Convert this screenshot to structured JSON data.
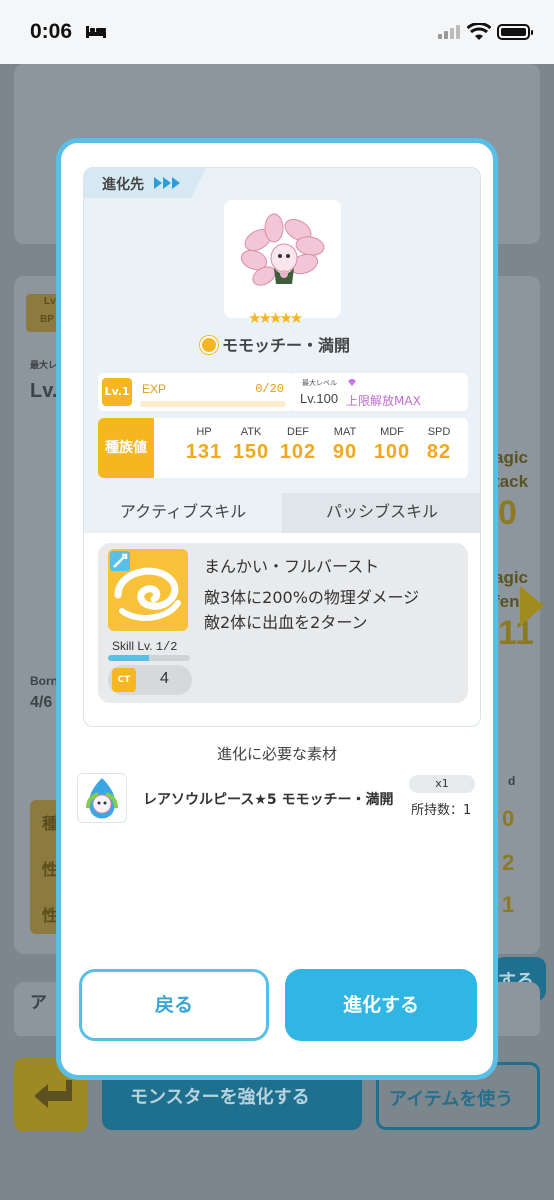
{
  "status_bar": {
    "time": "0:06"
  },
  "background": {
    "lv_badge": "Lv",
    "bp_label": "BP",
    "max_level_label": "最大レ",
    "lv_value": "Lv.",
    "born_label": "Born",
    "born_value": "4/6",
    "magic_attack_1": "agic",
    "magic_attack_2": "tack",
    "magic_attack_value": "0",
    "magic_defense_1": "agic",
    "magic_defense_2": "fen",
    "magic_defense_value": "11",
    "col_header": "d",
    "row_values": [
      "0",
      "2",
      "1"
    ],
    "row_label_1": "種",
    "row_label_2": "性",
    "row_label_3": "性",
    "evolve_btn_partial": "する",
    "item_label": "ア",
    "enhance_button": "モンスターを強化する",
    "use_item_button": "アイテムを使う"
  },
  "modal": {
    "header_tag": "進化先",
    "monster_name": "モモッチー・満開",
    "stars": "★★★★★",
    "level": {
      "badge": "Lv.1",
      "exp_label": "EXP",
      "exp_value": "0/20",
      "exp_progress": 0
    },
    "max_level": {
      "label": "最大レベル",
      "value": "Lv.100",
      "limit_text": "上限解放MAX"
    },
    "stats": {
      "label": "種族値",
      "items": [
        {
          "name": "HP",
          "value": "131"
        },
        {
          "name": "ATK",
          "value": "150"
        },
        {
          "name": "DEF",
          "value": "102"
        },
        {
          "name": "MAT",
          "value": "90"
        },
        {
          "name": "MDF",
          "value": "100"
        },
        {
          "name": "SPD",
          "value": "82"
        }
      ]
    },
    "tabs": {
      "active": "アクティブスキル",
      "passive": "パッシブスキル"
    },
    "skill": {
      "name": "まんかい・フルバースト",
      "desc_line1": "敵3体に200%の物理ダメージ",
      "desc_line2": "敵2体に出血を2ターン",
      "level_label": "Skill Lv.",
      "level_value": "1/2",
      "level_progress": 0.5,
      "ct_label": "CT",
      "ct_value": "4"
    },
    "materials": {
      "title": "進化に必要な素材",
      "item_name": "レアソウルピース★5 モモッチー・満開",
      "required_qty": "x1",
      "owned_label": "所持数：1"
    },
    "buttons": {
      "back": "戻る",
      "evolve": "進化する"
    }
  },
  "colors": {
    "accent": "#59bfe7",
    "gold": "#f5b621",
    "primary_button": "#31b5e2"
  }
}
